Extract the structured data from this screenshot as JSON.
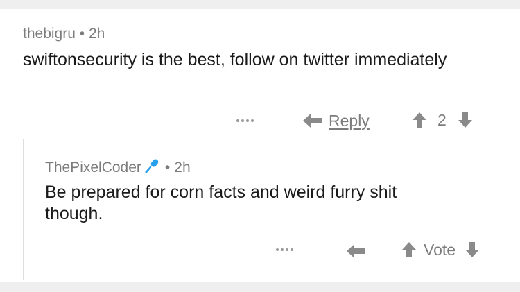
{
  "comment": {
    "author": "thebigru",
    "age": "2h",
    "text": "swiftonsecurity is the best, follow on twitter immediately",
    "reply_label": "Reply",
    "score": "2"
  },
  "reply": {
    "author": "ThePixelCoder",
    "flair_icon": "microphone-icon",
    "age": "2h",
    "text": "Be prepared for corn facts and weird furry shit though.",
    "vote_label": "Vote"
  },
  "icons": {
    "more": "more-dots-icon",
    "reply": "reply-arrow-icon",
    "upvote": "upvote-arrow-icon",
    "downvote": "downvote-arrow-icon"
  },
  "colors": {
    "background": "#efefef",
    "card": "#ffffff",
    "text": "#1a1a1b",
    "muted": "#7c7c7c",
    "flair": "#24a0ed"
  },
  "separator": "•"
}
